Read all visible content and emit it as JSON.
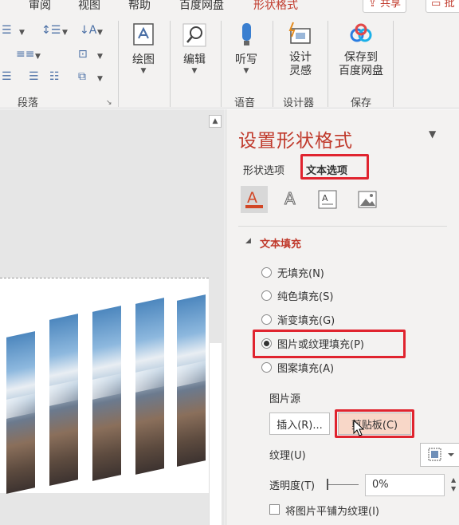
{
  "tabs": [
    "审阅",
    "视图",
    "帮助",
    "百度网盘",
    "形状格式"
  ],
  "active_tab": "形状格式",
  "title_buttons": {
    "share": "共享",
    "comment": "批"
  },
  "ribbon": {
    "groups": [
      {
        "label": "段落"
      },
      {
        "buttons": [
          {
            "label": "绘图",
            "icon": "draw-icon"
          }
        ]
      },
      {
        "buttons": [
          {
            "label": "编辑",
            "icon": "search-icon"
          }
        ]
      },
      {
        "label": "语音",
        "buttons": [
          {
            "label": "听写",
            "icon": "microphone-icon"
          }
        ]
      },
      {
        "label": "设计器",
        "buttons": [
          {
            "label": "设计\n灵感",
            "icon": "design-ideas-icon"
          }
        ]
      },
      {
        "label": "保存",
        "buttons": [
          {
            "label": "保存到\n百度网盘",
            "icon": "baidu-cloud-icon"
          }
        ]
      }
    ]
  },
  "pane": {
    "title": "设置形状格式",
    "tabs": [
      {
        "label": "形状选项",
        "active": false
      },
      {
        "label": "文本选项",
        "active": true
      }
    ],
    "icons": [
      "text-fill-outline-icon",
      "text-effects-icon",
      "textbox-icon",
      "picture-icon"
    ],
    "section": "文本填充",
    "options": [
      {
        "label": "无填充(N)",
        "checked": false
      },
      {
        "label": "纯色填充(S)",
        "checked": false
      },
      {
        "label": "渐变填充(G)",
        "checked": false
      },
      {
        "label": "图片或纹理填充(P)",
        "checked": true
      },
      {
        "label": "图案填充(A)",
        "checked": false
      }
    ],
    "picture_source": "图片源",
    "insert_button": "插入(R)...",
    "clipboard_button": "剪贴板(C)",
    "texture_label": "纹理(U)",
    "transparency_label": "透明度(T)",
    "transparency_value": "0%",
    "tile_label": "将图片平铺为纹理(I)"
  },
  "colors": {
    "accent": "#c0392b",
    "highlight": "#e0242f",
    "fill_orange": "#d24726"
  }
}
